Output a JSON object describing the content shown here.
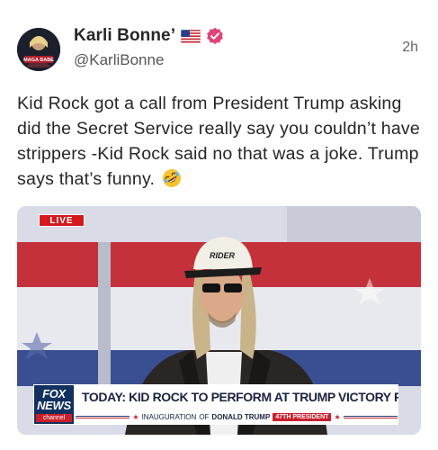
{
  "author": {
    "display_name": "Karli Bonne’",
    "handle": "@KarliBonne",
    "flag_icon": "us-flag-icon",
    "verified_icon": "verified-badge-icon",
    "verified_color": "#e0447a",
    "avatar_text": "MAGA BABE"
  },
  "timestamp": "2h",
  "post": {
    "text": "Kid Rock got a call from President Trump asking did the Secret Service really say you couldn’t have strippers -Kid Rock said no that was a joke. Trump says that’s funny.",
    "emoji": "rolling-on-floor-laughing-icon"
  },
  "media": {
    "live_label": "LIVE",
    "cap_text": "RIDER",
    "network": {
      "fox": "FOX",
      "news": "NEWS",
      "channel": "channel"
    },
    "chyron": {
      "headline": "TODAY: KID ROCK TO PERFORM AT TRUMP VICTORY RALLY",
      "sub_prefix": "INAUGURATION",
      "sub_of": "OF",
      "sub_name": "DONALD TRUMP",
      "sub_badge": "47TH PRESIDENT"
    },
    "colors": {
      "live_red": "#d41a1f",
      "fox_navy": "#12305f",
      "backdrop_red": "#c4313a"
    }
  }
}
